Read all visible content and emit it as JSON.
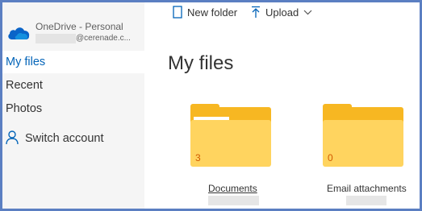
{
  "account": {
    "service": "OneDrive - Personal",
    "email_suffix": "@cerenade.c..."
  },
  "sidebar": {
    "items": [
      {
        "label": "My files",
        "active": true
      },
      {
        "label": "Recent",
        "active": false
      },
      {
        "label": "Photos",
        "active": false
      }
    ],
    "switch_account": "Switch account"
  },
  "command_bar": {
    "new_folder": "New folder",
    "upload": "Upload"
  },
  "main": {
    "title": "My files",
    "folders": [
      {
        "name": "Documents",
        "count": "3"
      },
      {
        "name": "Email attachments",
        "count": "0"
      }
    ]
  },
  "colors": {
    "accent": "#0364b8",
    "folder_back": "#f7b722",
    "folder_front": "#ffd45f",
    "frame": "#5b7fc2"
  }
}
